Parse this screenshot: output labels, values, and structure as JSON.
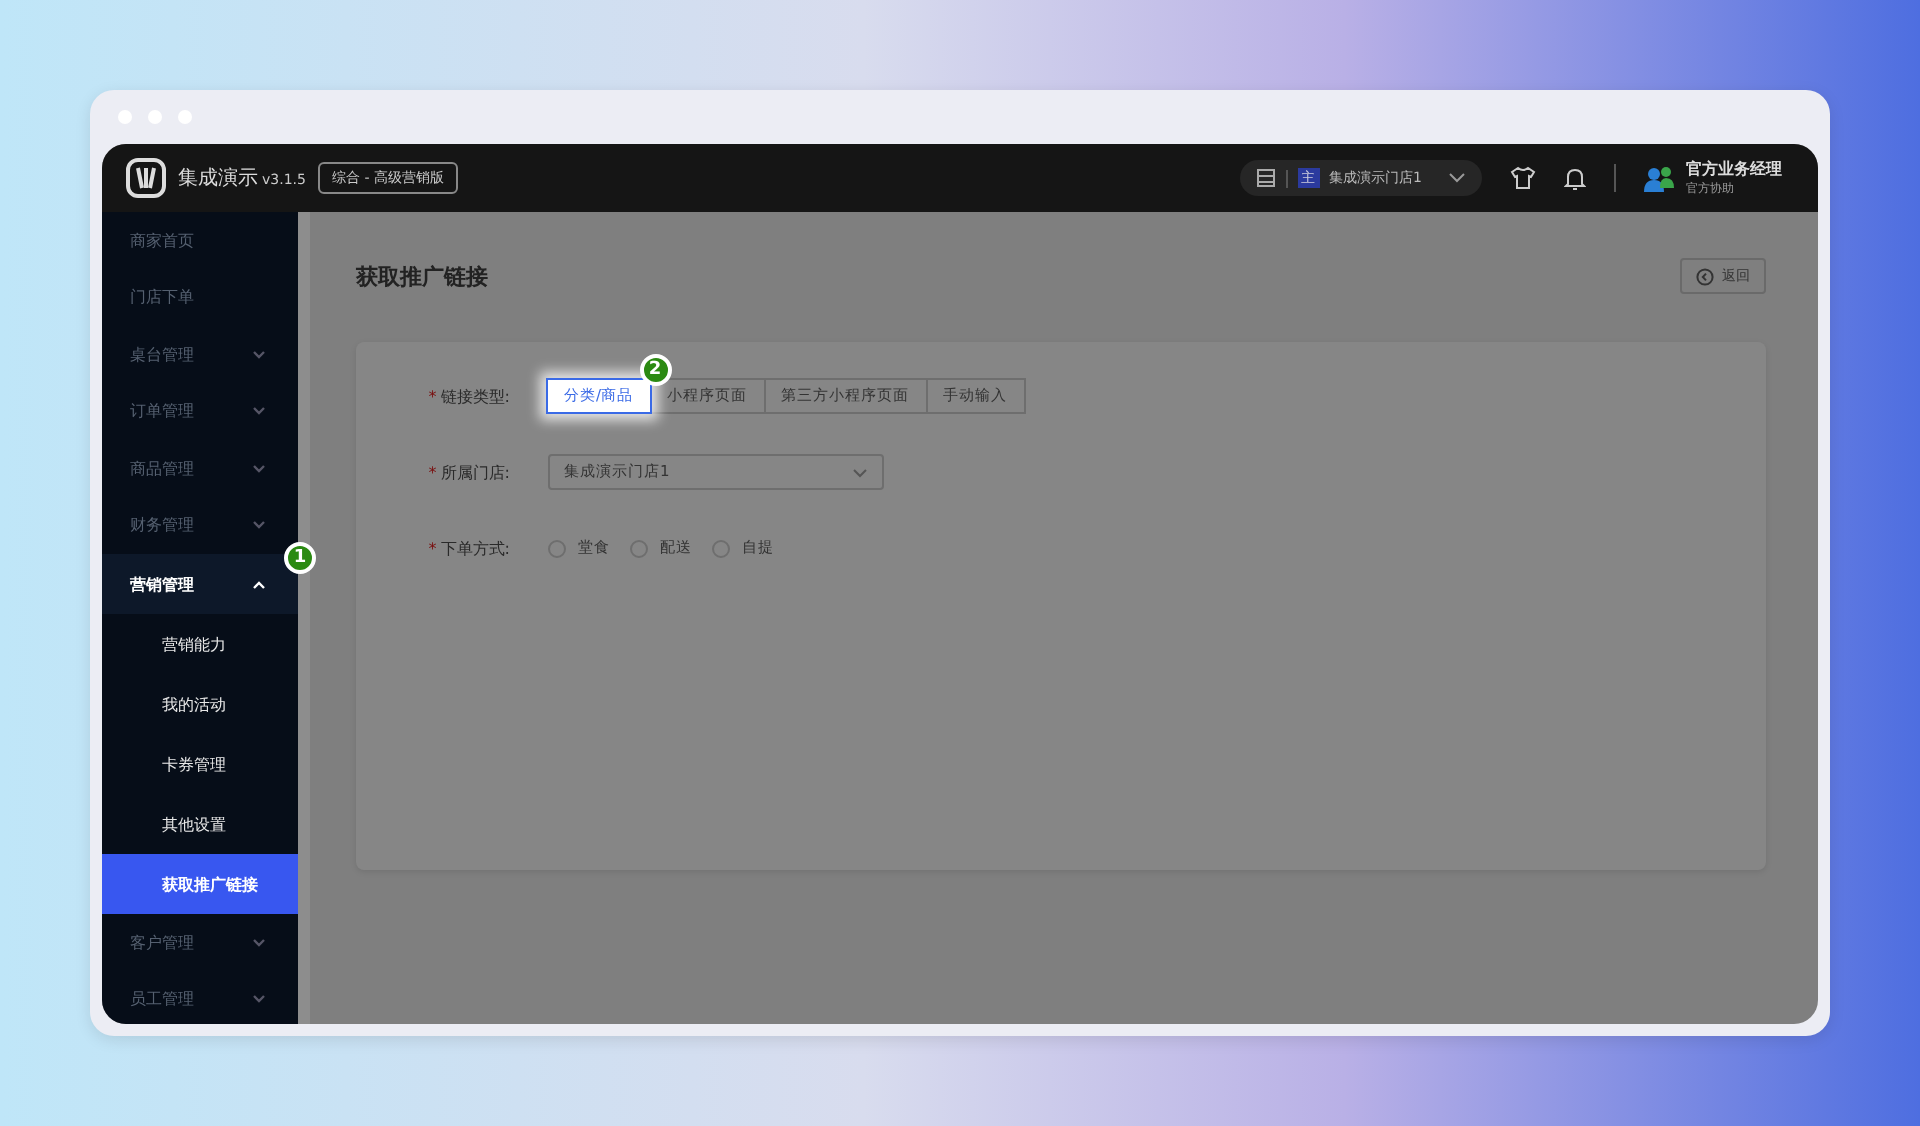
{
  "app": {
    "name": "集成演示",
    "version": "v3.1.5",
    "edition": "综合 - 高级营销版"
  },
  "topbar": {
    "store_badge": "主",
    "store": "集成演示门店1",
    "user_name": "官方业务经理",
    "user_role": "官方协助"
  },
  "sidebar": {
    "items": [
      {
        "label": "商家首页",
        "expandable": false,
        "expanded": false
      },
      {
        "label": "门店下单",
        "expandable": false,
        "expanded": false
      },
      {
        "label": "桌台管理",
        "expandable": true,
        "expanded": false
      },
      {
        "label": "订单管理",
        "expandable": true,
        "expanded": false
      },
      {
        "label": "商品管理",
        "expandable": true,
        "expanded": false
      },
      {
        "label": "财务管理",
        "expandable": true,
        "expanded": false
      },
      {
        "label": "营销管理",
        "expandable": true,
        "expanded": true,
        "badge": "1",
        "children": [
          {
            "label": "营销能力",
            "selected": false
          },
          {
            "label": "我的活动",
            "selected": false
          },
          {
            "label": "卡券管理",
            "selected": false
          },
          {
            "label": "其他设置",
            "selected": false
          },
          {
            "label": "获取推广链接",
            "selected": true
          }
        ]
      },
      {
        "label": "客户管理",
        "expandable": true,
        "expanded": false
      },
      {
        "label": "员工管理",
        "expandable": true,
        "expanded": false
      }
    ]
  },
  "page": {
    "title": "获取推广链接",
    "back_button": "返回"
  },
  "form": {
    "link_type": {
      "label": "链接类型:",
      "required_mark": "*",
      "options": [
        {
          "label": "分类/商品",
          "selected": true,
          "badge": "2"
        },
        {
          "label": "小程序页面",
          "selected": false
        },
        {
          "label": "第三方小程序页面",
          "selected": false
        },
        {
          "label": "手动输入",
          "selected": false
        }
      ]
    },
    "store": {
      "label": "所属门店:",
      "required_mark": "*",
      "value": "集成演示门店1"
    },
    "order_mode": {
      "label": "下单方式:",
      "required_mark": "*",
      "options": [
        {
          "label": "堂食",
          "checked": false
        },
        {
          "label": "配送",
          "checked": false
        },
        {
          "label": "自提",
          "checked": false
        }
      ]
    }
  }
}
